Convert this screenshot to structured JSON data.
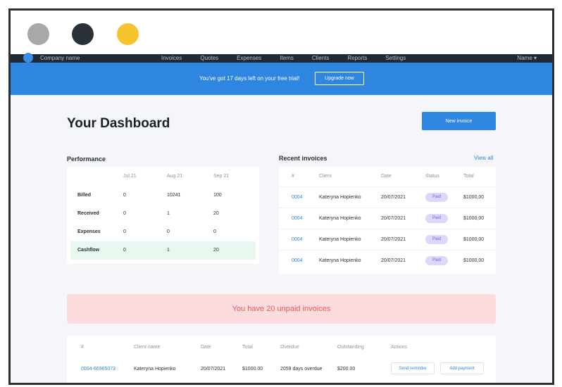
{
  "window_dots": [
    "gray-dot",
    "dark-dot",
    "yellow-dot"
  ],
  "nav": {
    "company": "Company name",
    "links": [
      "Invoices",
      "Quotes",
      "Expenses",
      "Items",
      "Clients",
      "Reports",
      "Settings"
    ],
    "user": "Name ▾"
  },
  "trial": {
    "message": "You've got 17 days left on your free trial!",
    "button": "Upgrade now"
  },
  "dashboard": {
    "title": "Your Dashboard",
    "new_invoice": "New invoice"
  },
  "performance": {
    "label": "Performance",
    "columns": [
      "Jul 21",
      "Aug 21",
      "Sep 21"
    ],
    "rows": [
      {
        "name": "Billed",
        "values": [
          "0",
          "10241",
          "100"
        ]
      },
      {
        "name": "Received",
        "values": [
          "0",
          "1",
          "20"
        ]
      },
      {
        "name": "Expenses",
        "values": [
          "0",
          "0",
          "0"
        ]
      },
      {
        "name": "Cashflow",
        "values": [
          "0",
          "1",
          "20"
        ]
      }
    ]
  },
  "recent": {
    "label": "Recent invoices",
    "view_all": "View all",
    "columns": [
      "#",
      "Client",
      "Date",
      "Status",
      "Total"
    ],
    "rows": [
      {
        "num": "0004",
        "client": "Kateryna Hopienko",
        "date": "20/07/2021",
        "status": "Paid",
        "total": "$1000,00"
      },
      {
        "num": "0004",
        "client": "Kateryna Hopienko",
        "date": "20/07/2021",
        "status": "Paid",
        "total": "$1000,00"
      },
      {
        "num": "0004",
        "client": "Kateryna Hopienko",
        "date": "20/07/2021",
        "status": "Paid",
        "total": "$1000,00"
      },
      {
        "num": "0004",
        "client": "Kateryna Hopienko",
        "date": "20/07/2021",
        "status": "Paid",
        "total": "$1000,00"
      }
    ]
  },
  "unpaid": {
    "message": "You have 20 unpaid invoices"
  },
  "unpaid_table": {
    "columns": [
      "#",
      "Client name",
      "Date",
      "Total",
      "Overdue",
      "Outstanding",
      "Actions"
    ],
    "row": {
      "num": "0004-66965073",
      "client": "Kateryna Hopienko",
      "date": "20/07/2021",
      "total": "$1000.00",
      "overdue": "2059 days overdue",
      "outstanding": "$200.00",
      "send_reminder": "Send reminder",
      "add_payment": "Add payment"
    }
  }
}
